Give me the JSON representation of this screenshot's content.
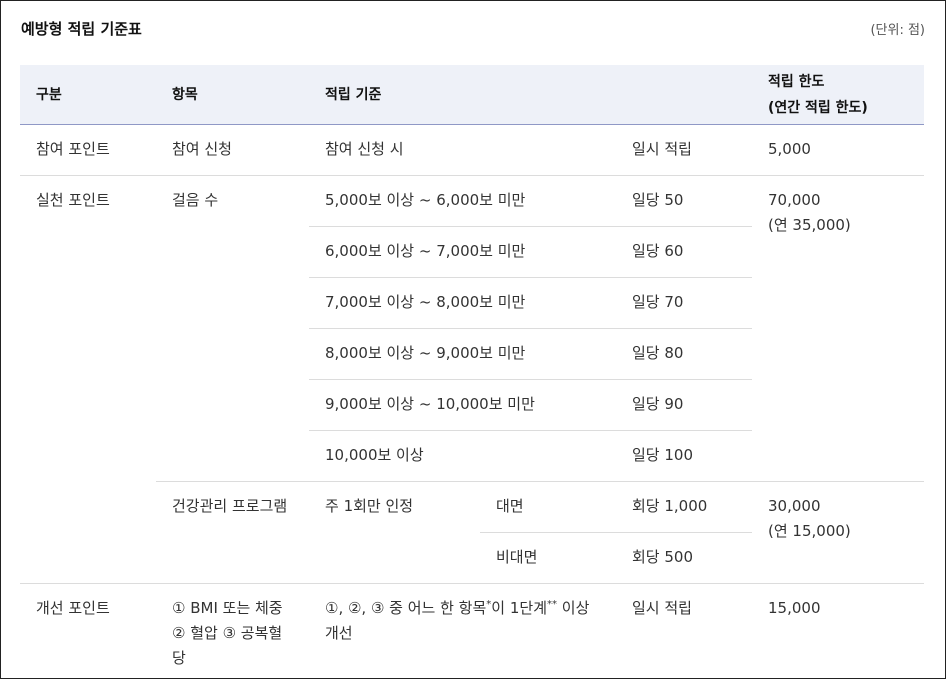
{
  "title": "예방형 적립 기준표",
  "unit": "(단위: 점)",
  "headers": {
    "category": "구분",
    "item": "항목",
    "criteria": "적립 기준",
    "limit_line1": "적립 한도",
    "limit_line2": "(연간 적립 한도)"
  },
  "participation": {
    "category": "참여 포인트",
    "item": "참여 신청",
    "criteria": "참여 신청 시",
    "amount": "일시 적립",
    "limit": "5,000"
  },
  "practice": {
    "category": "실천 포인트",
    "steps": {
      "item": "걸음 수",
      "limit_line1": "70,000",
      "limit_line2": "(연 35,000)",
      "rows": [
        {
          "criteria": "5,000보 이상 ~ 6,000보 미만",
          "amount": "일당 50"
        },
        {
          "criteria": "6,000보 이상 ~ 7,000보 미만",
          "amount": "일당 60"
        },
        {
          "criteria": "7,000보 이상 ~ 8,000보 미만",
          "amount": "일당 70"
        },
        {
          "criteria": "8,000보 이상 ~ 9,000보 미만",
          "amount": "일당 80"
        },
        {
          "criteria": "9,000보 이상 ~ 10,000보 미만",
          "amount": "일당 90"
        },
        {
          "criteria": "10,000보 이상",
          "amount": "일당 100"
        }
      ]
    },
    "program": {
      "item": "건강관리 프로그램",
      "criteria": "주 1회만 인정",
      "limit_line1": "30,000",
      "limit_line2": "(연 15,000)",
      "rows": [
        {
          "type": "대면",
          "amount": "회당 1,000"
        },
        {
          "type": "비대면",
          "amount": "회당 500"
        }
      ]
    }
  },
  "improvement": {
    "category": "개선 포인트",
    "item_line1": "① BMI 또는 체중",
    "item_line2": "② 혈압 ③ 공복혈당",
    "criteria_pre": "①, ②, ③ 중 어느 한 항목",
    "criteria_sup1": "*",
    "criteria_mid": "이 1단계",
    "criteria_sup2": "**",
    "criteria_post": " 이상 개선",
    "amount": "일시 적립",
    "limit": "15,000"
  }
}
